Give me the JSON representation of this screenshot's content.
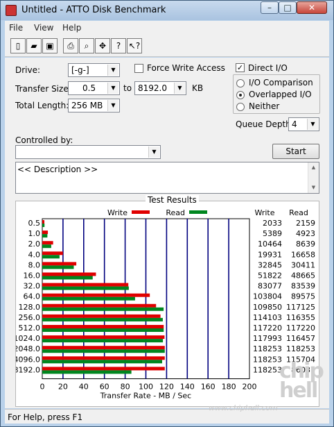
{
  "window": {
    "title": "Untitled - ATTO Disk Benchmark",
    "min_icon": "minimize-icon",
    "max_icon": "maximize-icon",
    "close_icon": "close-icon",
    "min_glyph": "–",
    "max_glyph": "□",
    "close_glyph": "✕"
  },
  "menu": {
    "file": "File",
    "view": "View",
    "help": "Help"
  },
  "toolbar": [
    {
      "name": "new-icon",
      "glyph": "▯"
    },
    {
      "name": "open-icon",
      "glyph": "▰"
    },
    {
      "name": "save-icon",
      "glyph": "▣"
    },
    {
      "name": "print-icon",
      "glyph": "⎙"
    },
    {
      "name": "print-preview-icon",
      "glyph": "⌕"
    },
    {
      "name": "move-icon",
      "glyph": "✥"
    },
    {
      "name": "help-icon",
      "glyph": "?"
    },
    {
      "name": "context-help-icon",
      "glyph": "↖?"
    }
  ],
  "form": {
    "drive_label": "Drive:",
    "drive_value": "[-g-]",
    "force_write_label": "Force Write Access",
    "direct_io_label": "Direct I/O",
    "direct_io_checked": true,
    "transfer_size_label": "Transfer Size:",
    "transfer_from": "0.5",
    "to_label": "to",
    "transfer_to": "8192.0",
    "kb_label": "KB",
    "total_length_label": "Total Length:",
    "total_length_value": "256 MB",
    "io_comparison_label": "I/O Comparison",
    "overlapped_io_label": "Overlapped I/O",
    "neither_label": "Neither",
    "queue_depth_label": "Queue Depth:",
    "queue_depth_value": "4",
    "controlled_by_label": "Controlled by:",
    "controlled_by_value": "",
    "start_label": "Start",
    "description": "<< Description >>"
  },
  "results": {
    "title": "Test Results",
    "write_legend": "Write",
    "read_legend": "Read",
    "write_col": "Write",
    "read_col": "Read",
    "xlabel": "Transfer Rate - MB / Sec",
    "write_color": "#e00000",
    "read_color": "#00861f"
  },
  "chart_data": {
    "type": "bar",
    "orientation": "horizontal",
    "categories": [
      "0.5",
      "1.0",
      "2.0",
      "4.0",
      "8.0",
      "16.0",
      "32.0",
      "64.0",
      "128.0",
      "256.0",
      "512.0",
      "1024.0",
      "2048.0",
      "4096.0",
      "8192.0"
    ],
    "series": [
      {
        "name": "Write",
        "values": [
          2033,
          5389,
          10464,
          19931,
          32845,
          51822,
          83077,
          103804,
          109850,
          114103,
          117220,
          117993,
          118253,
          118253,
          118253
        ]
      },
      {
        "name": "Read",
        "values": [
          2159,
          4923,
          8639,
          16658,
          30411,
          48665,
          83539,
          89575,
          117125,
          116355,
          117220,
          116457,
          118253,
          115704,
          86037
        ]
      }
    ],
    "xticks": [
      "0",
      "20",
      "40",
      "60",
      "80",
      "100",
      "120",
      "140",
      "160",
      "180",
      "200"
    ],
    "xlim": [
      0,
      200
    ],
    "xlabel": "Transfer Rate - MB / Sec",
    "legend": "top"
  },
  "status": {
    "text": "For Help, press F1"
  },
  "watermark": {
    "url": "www.chiphell.com",
    "logo": "chip hell"
  }
}
